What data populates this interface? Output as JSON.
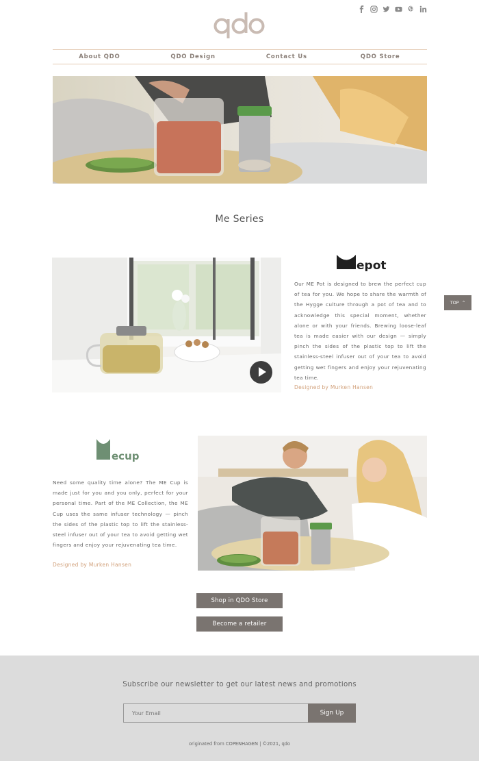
{
  "social": {
    "icons": [
      "facebook-icon",
      "instagram-icon",
      "twitter-icon",
      "youtube-icon",
      "pinterest-icon",
      "linkedin-icon"
    ]
  },
  "logo": {
    "text": "qdo",
    "color": "#c9bbb3"
  },
  "nav": {
    "items": [
      "About QDO",
      "QDO Design",
      "Contact Us",
      "QDO Store"
    ]
  },
  "section_title": "Me Series",
  "pot": {
    "logo_text": "epot",
    "description": "Our ME Pot is designed to brew the perfect cup of tea for you. We hope to share the warmth of the Hygge culture through a pot of tea and to acknowledge this special moment, whether alone or with your friends. Brewing loose-leaf tea is made easier with our design — simply pinch the sides of the plastic top to lift the stainless-steel infuser out of your tea to avoid getting wet fingers and enjoy your rejuvenating tea time.",
    "designer": "Designed by Murken Hansen"
  },
  "cup": {
    "logo_text": "ecup",
    "description": "Need some quality time alone? The ME Cup is made just for you and you only, perfect for your personal time. Part of the ME Collection, the ME Cup uses the same infuser technology — pinch the sides of the plastic top to lift the stainless-steel infuser out of your tea to avoid getting wet fingers and enjoy your rejuvenating tea time.",
    "designer": "Designed by Murken Hansen"
  },
  "top_button": "TOP",
  "buttons": {
    "shop": "Shop in QDO Store",
    "retailer": "Become a retailer"
  },
  "footer": {
    "newsletter": "Subscribe our newsletter to get our latest news and promotions",
    "email_placeholder": "Your Email",
    "signup": "Sign Up",
    "copyright": "originated from COPENHAGEN   |   ©2021, qdo"
  },
  "colors": {
    "accent": "#d1a07a",
    "button": "#7a7470",
    "pot_logo": "#1f1f1f",
    "cup_logo": "#6e8f73",
    "footer_bg": "#dcdcdc"
  }
}
